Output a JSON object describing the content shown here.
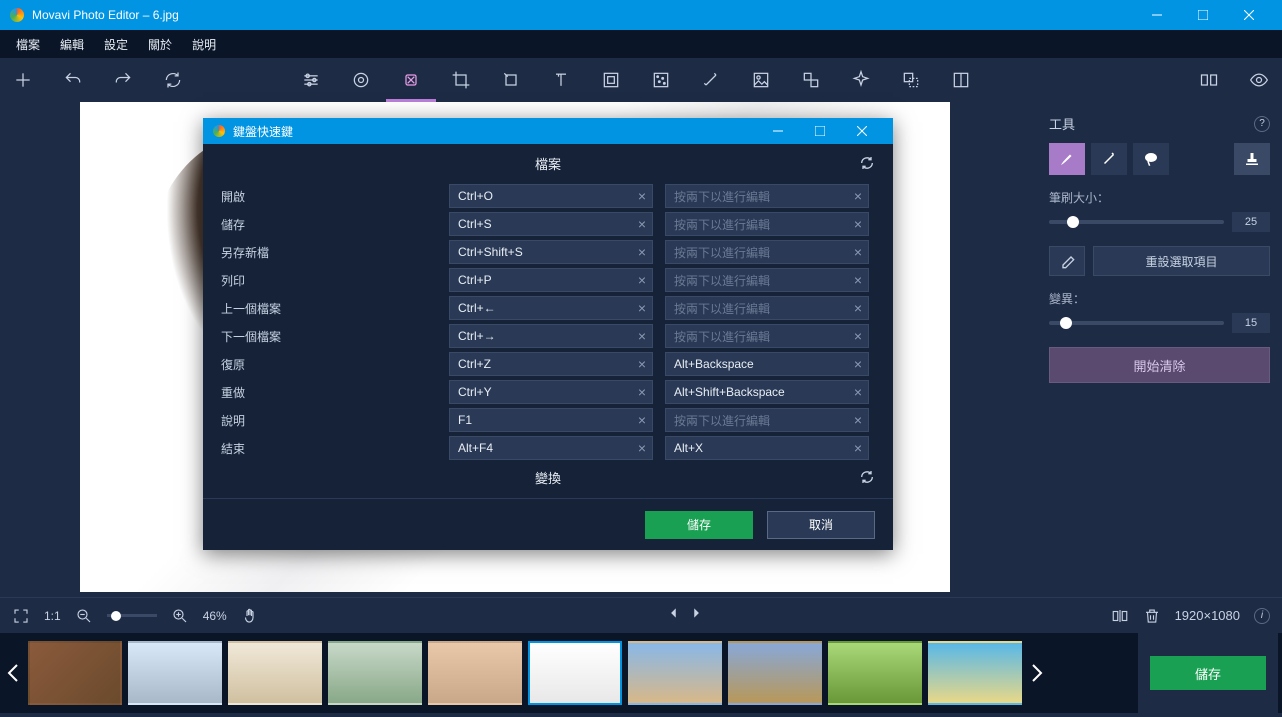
{
  "titlebar": {
    "app": "Movavi Photo Editor",
    "file": "6.jpg"
  },
  "menubar": [
    "檔案",
    "編輯",
    "設定",
    "關於",
    "說明"
  ],
  "sidebar": {
    "title": "工具",
    "brush_label": "筆刷大小：",
    "brush_value": "25",
    "reset_label": "重設選取項目",
    "variance_label": "變異：",
    "variance_value": "15",
    "action_label": "開始清除"
  },
  "status": {
    "ratio": "1:1",
    "zoom": "46%",
    "resolution": "1920×1080"
  },
  "save_label": "儲存",
  "dialog": {
    "title": "鍵盤快速鍵",
    "section": "檔案",
    "section2": "變換",
    "placeholder": "按兩下以進行編輯",
    "rows": [
      {
        "label": "開啟",
        "key1": "Ctrl+O",
        "key2": ""
      },
      {
        "label": "儲存",
        "key1": "Ctrl+S",
        "key2": ""
      },
      {
        "label": "另存新檔",
        "key1": "Ctrl+Shift+S",
        "key2": ""
      },
      {
        "label": "列印",
        "key1": "Ctrl+P",
        "key2": ""
      },
      {
        "label": "上一個檔案",
        "key1": "Ctrl+←",
        "key2": ""
      },
      {
        "label": "下一個檔案",
        "key1": "Ctrl+→",
        "key2": ""
      },
      {
        "label": "復原",
        "key1": "Ctrl+Z",
        "key2": "Alt+Backspace"
      },
      {
        "label": "重做",
        "key1": "Ctrl+Y",
        "key2": "Alt+Shift+Backspace"
      },
      {
        "label": "說明",
        "key1": "F1",
        "key2": ""
      },
      {
        "label": "結束",
        "key1": "Alt+F4",
        "key2": "Alt+X"
      }
    ],
    "save_btn": "儲存",
    "cancel_btn": "取消"
  }
}
